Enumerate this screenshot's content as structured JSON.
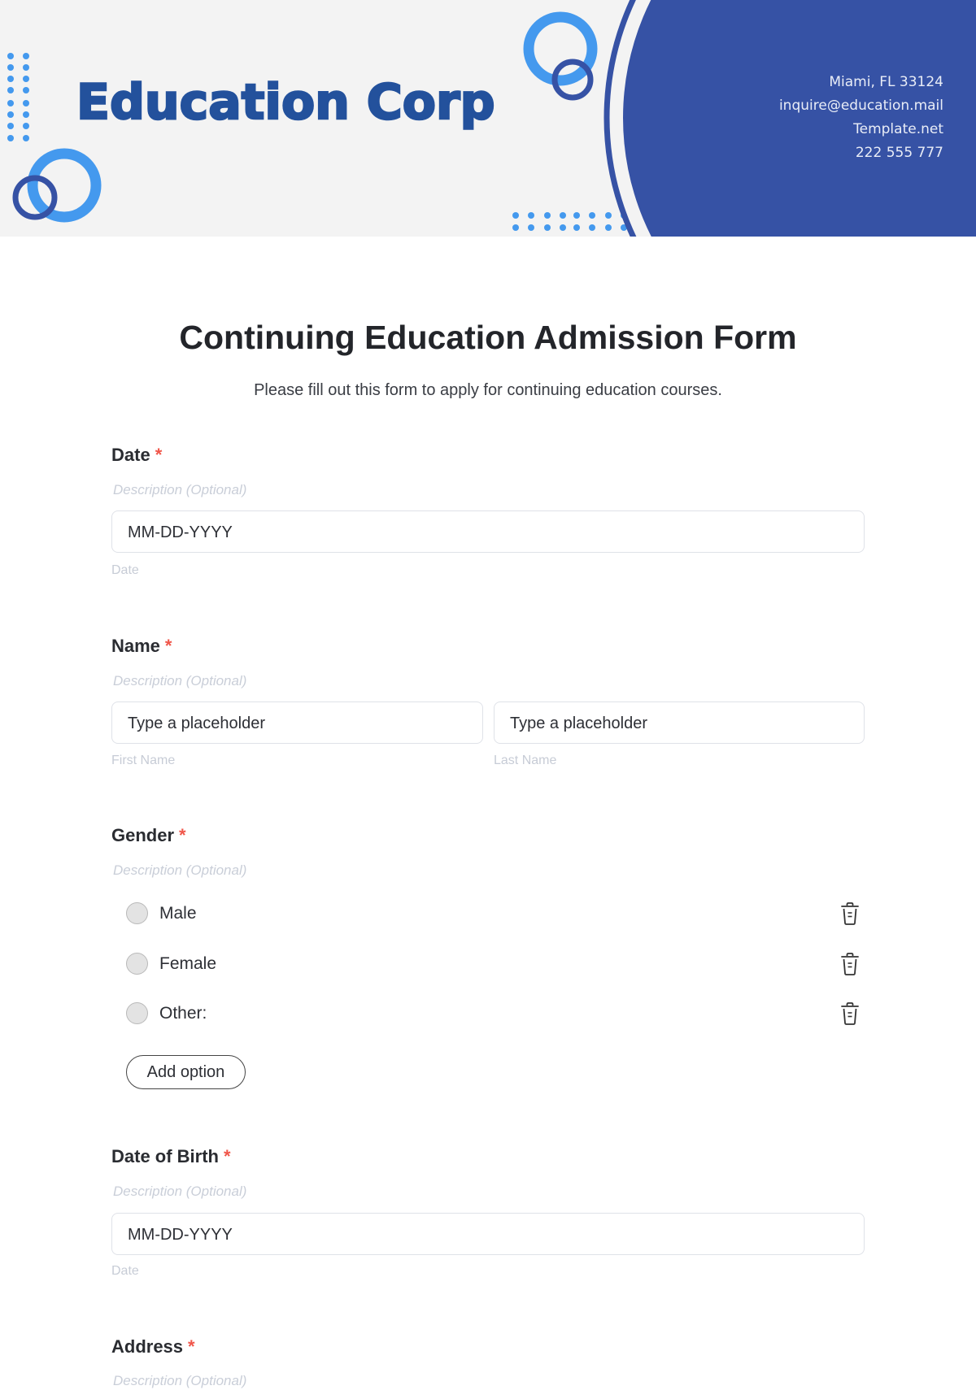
{
  "header": {
    "company_name": "Education Corp",
    "contact": {
      "address": "Miami, FL 33124",
      "email": "inquire@education.mail",
      "website": "Template.net",
      "phone": "222 555 777"
    },
    "colors": {
      "background": "#f3f3f3",
      "brand_dark_blue": "#23519c",
      "panel_blue": "#3652a5",
      "accent_light_blue": "#4499ee"
    }
  },
  "form": {
    "title": "Continuing Education Admission Form",
    "subtitle": "Please fill out this form to apply for continuing education courses.",
    "required_marker": "*",
    "required_color": "#f0564a",
    "fields": {
      "date": {
        "label": "Date",
        "description_placeholder": "Description (Optional)",
        "input_placeholder": "MM-DD-YYYY",
        "sub_label": "Date"
      },
      "name": {
        "label": "Name",
        "description_placeholder": "Description (Optional)",
        "first": {
          "input_placeholder": "Type a placeholder",
          "sub_label": "First Name"
        },
        "last": {
          "input_placeholder": "Type a placeholder",
          "sub_label": "Last Name"
        }
      },
      "gender": {
        "label": "Gender",
        "description_placeholder": "Description (Optional)",
        "options": [
          {
            "label": "Male",
            "icon": "trash-icon"
          },
          {
            "label": "Female",
            "icon": "trash-icon"
          },
          {
            "label": "Other:",
            "icon": "trash-icon"
          }
        ],
        "add_option_label": "Add option"
      },
      "date_of_birth": {
        "label": "Date of Birth",
        "description_placeholder": "Description (Optional)",
        "input_placeholder": "MM-DD-YYYY",
        "sub_label": "Date"
      },
      "address": {
        "label": "Address",
        "description_placeholder": "Description (Optional)"
      }
    }
  }
}
